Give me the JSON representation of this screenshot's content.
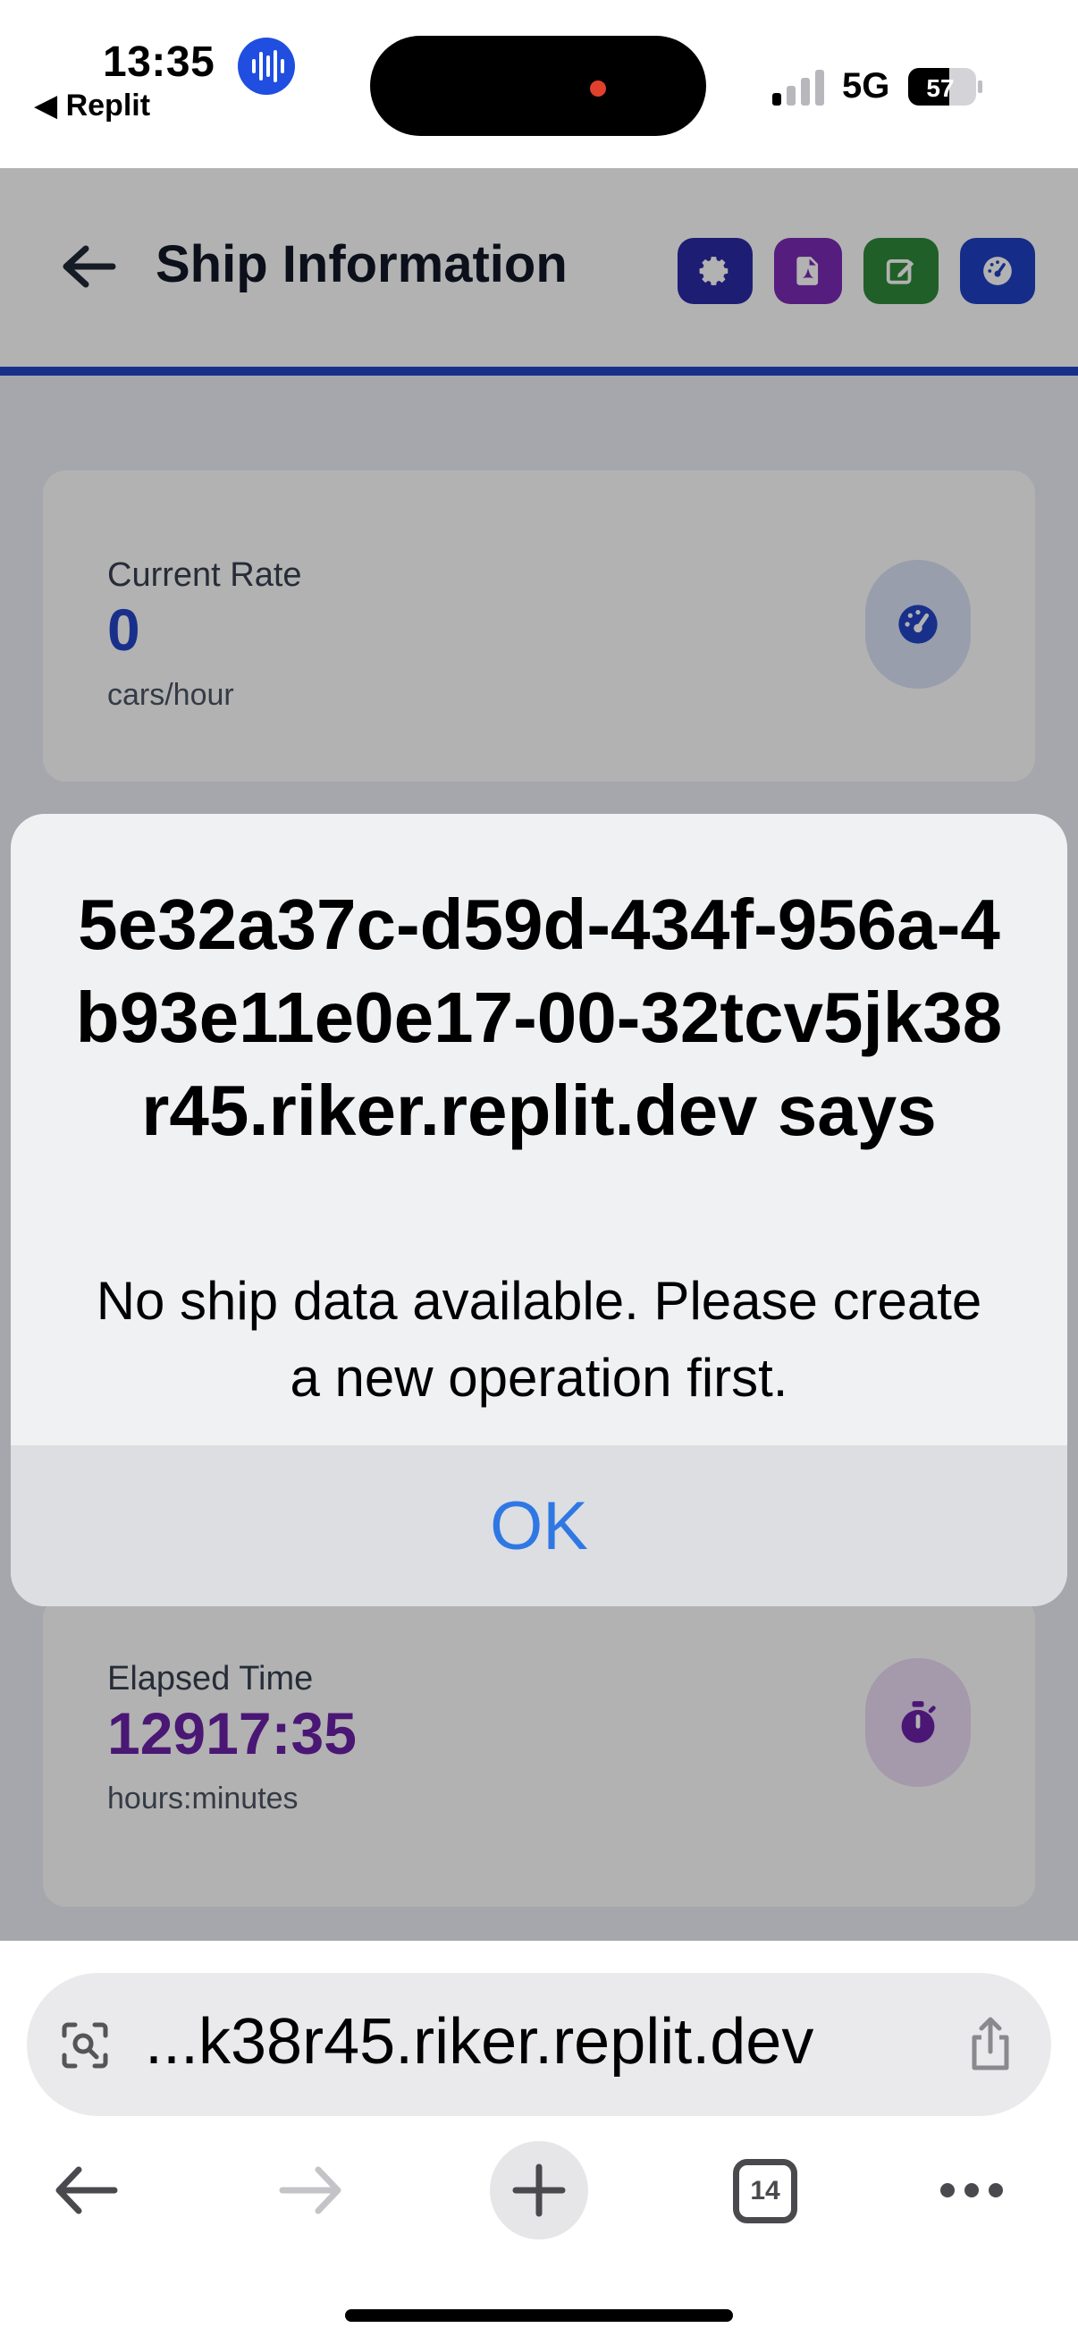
{
  "status_bar": {
    "time": "13:35",
    "back_app": "◀ Replit",
    "network": "5G",
    "battery": "57",
    "icons": [
      "voice-activity-icon",
      "signal-icon",
      "battery-icon"
    ]
  },
  "app": {
    "header": {
      "back_icon": "arrow-left-icon",
      "title": "Ship Information",
      "actions": [
        {
          "icon": "gear-icon",
          "color": "#2a2aa6"
        },
        {
          "icon": "pdf-file-icon",
          "color": "#7a2ab3"
        },
        {
          "icon": "edit-icon",
          "color": "#2f8a3a"
        },
        {
          "icon": "gauge-icon",
          "color": "#2040c4"
        }
      ],
      "accent_color": "#2446c8"
    },
    "cards": [
      {
        "label": "Current Rate",
        "value": "0",
        "unit": "cars/hour",
        "icon": "gauge-icon",
        "color": "#2446c8"
      },
      {
        "label": "Elapsed Time",
        "value": "12917:35",
        "unit": "hours:minutes",
        "icon": "stopwatch-icon",
        "color": "#6b21a8"
      }
    ]
  },
  "alert": {
    "title": "5e32a37c-d59d-434f-956a-4b93e11e0e17-00-32tcv5jk38r45.riker.replit.dev says",
    "message": "No ship data available. Please create a new operation first.",
    "ok_label": "OK",
    "ok_color": "#2f78e4"
  },
  "browser": {
    "url": "...k38r45.riker.replit.dev",
    "tab_count": "14",
    "icons": [
      "page-lens-icon",
      "share-icon",
      "back-arrow-icon",
      "forward-arrow-icon",
      "new-tab-plus-icon",
      "tabs-icon",
      "more-icon"
    ]
  }
}
